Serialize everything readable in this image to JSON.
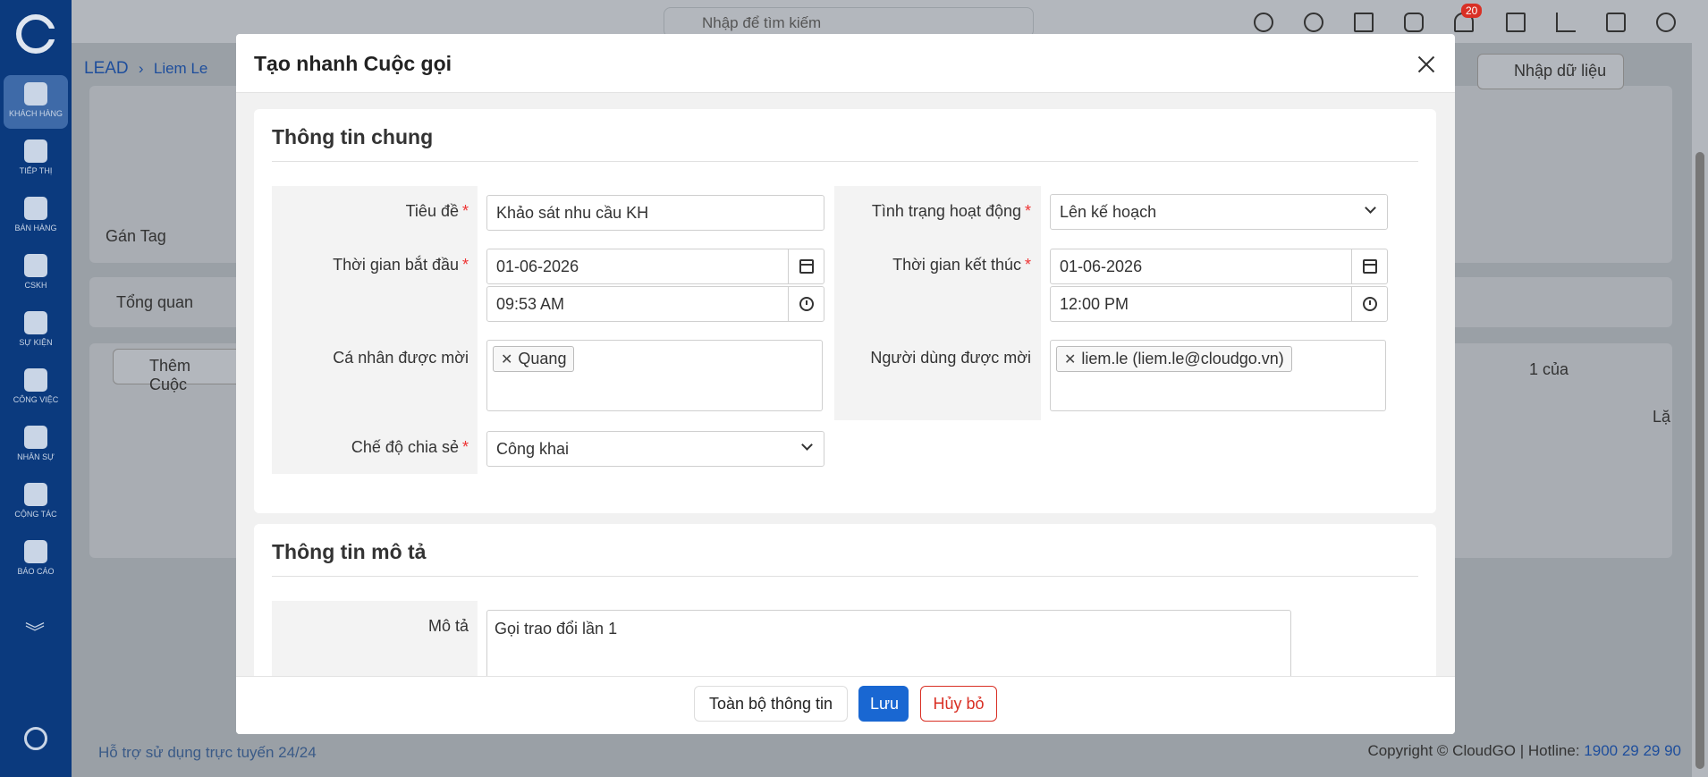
{
  "sidebar": {
    "items": [
      {
        "label": "KHÁCH HÀNG",
        "icon": "users-icon"
      },
      {
        "label": "TIẾP THỊ",
        "icon": "megaphone-icon"
      },
      {
        "label": "BÁN HÀNG",
        "icon": "cart-icon"
      },
      {
        "label": "CSKH",
        "icon": "lifebuoy-icon"
      },
      {
        "label": "SỰ KIỆN",
        "icon": "calendar-icon"
      },
      {
        "label": "CÔNG VIỆC",
        "icon": "briefcase-icon"
      },
      {
        "label": "NHÂN SỰ",
        "icon": "person-icon"
      },
      {
        "label": "CỘNG TÁC",
        "icon": "org-chart-icon"
      },
      {
        "label": "BÁO CÁO",
        "icon": "report-icon"
      }
    ]
  },
  "topbar": {
    "search_placeholder": "Nhập để tìm kiếm",
    "notification_count": "20"
  },
  "breadcrumb": {
    "root": "LEAD",
    "current": "Liem Le"
  },
  "background": {
    "tag_label": "Gán Tag",
    "tab_overview": "Tổng quan",
    "add_call": "Thêm Cuộc",
    "import_label": "Nhập dữ liệu",
    "pager_text": "1 của",
    "repeat_col": "Lặ"
  },
  "modal": {
    "title": "Tạo nhanh Cuộc gọi",
    "section_general": "Thông tin chung",
    "section_desc": "Thông tin mô tả",
    "fields": {
      "subject_label": "Tiêu đề",
      "subject_value": "Khảo sát nhu cầu KH",
      "status_label": "Tình trạng hoạt động",
      "status_value": "Lên kế hoạch",
      "start_label": "Thời gian bắt đầu",
      "start_date": "01-06-2026",
      "start_time": "09:53 AM",
      "end_label": "Thời gian kết thúc",
      "end_date": "01-06-2026",
      "end_time": "12:00 PM",
      "invitees_label": "Cá nhân được mời",
      "invitees": [
        "Quang"
      ],
      "users_label": "Người dùng được mời",
      "users": [
        "liem.le (liem.le@cloudgo.vn)"
      ],
      "share_label": "Chế độ chia sẻ",
      "share_value": "Công khai",
      "desc_label": "Mô tả",
      "desc_value": "Gọi trao đổi lần 1"
    },
    "footer": {
      "full_info": "Toàn bộ thông tin",
      "save": "Lưu",
      "cancel": "Hủy bỏ"
    }
  },
  "footer": {
    "support": "Hỗ trợ sử dụng trực tuyến 24/24",
    "copyright": "Copyright © CloudGO",
    "hotline_label": "Hotline:",
    "hotline": "1900 29 29 90"
  },
  "colors": {
    "primary": "#1967d2",
    "sidebar": "#0b3a7e",
    "danger": "#d93025"
  }
}
